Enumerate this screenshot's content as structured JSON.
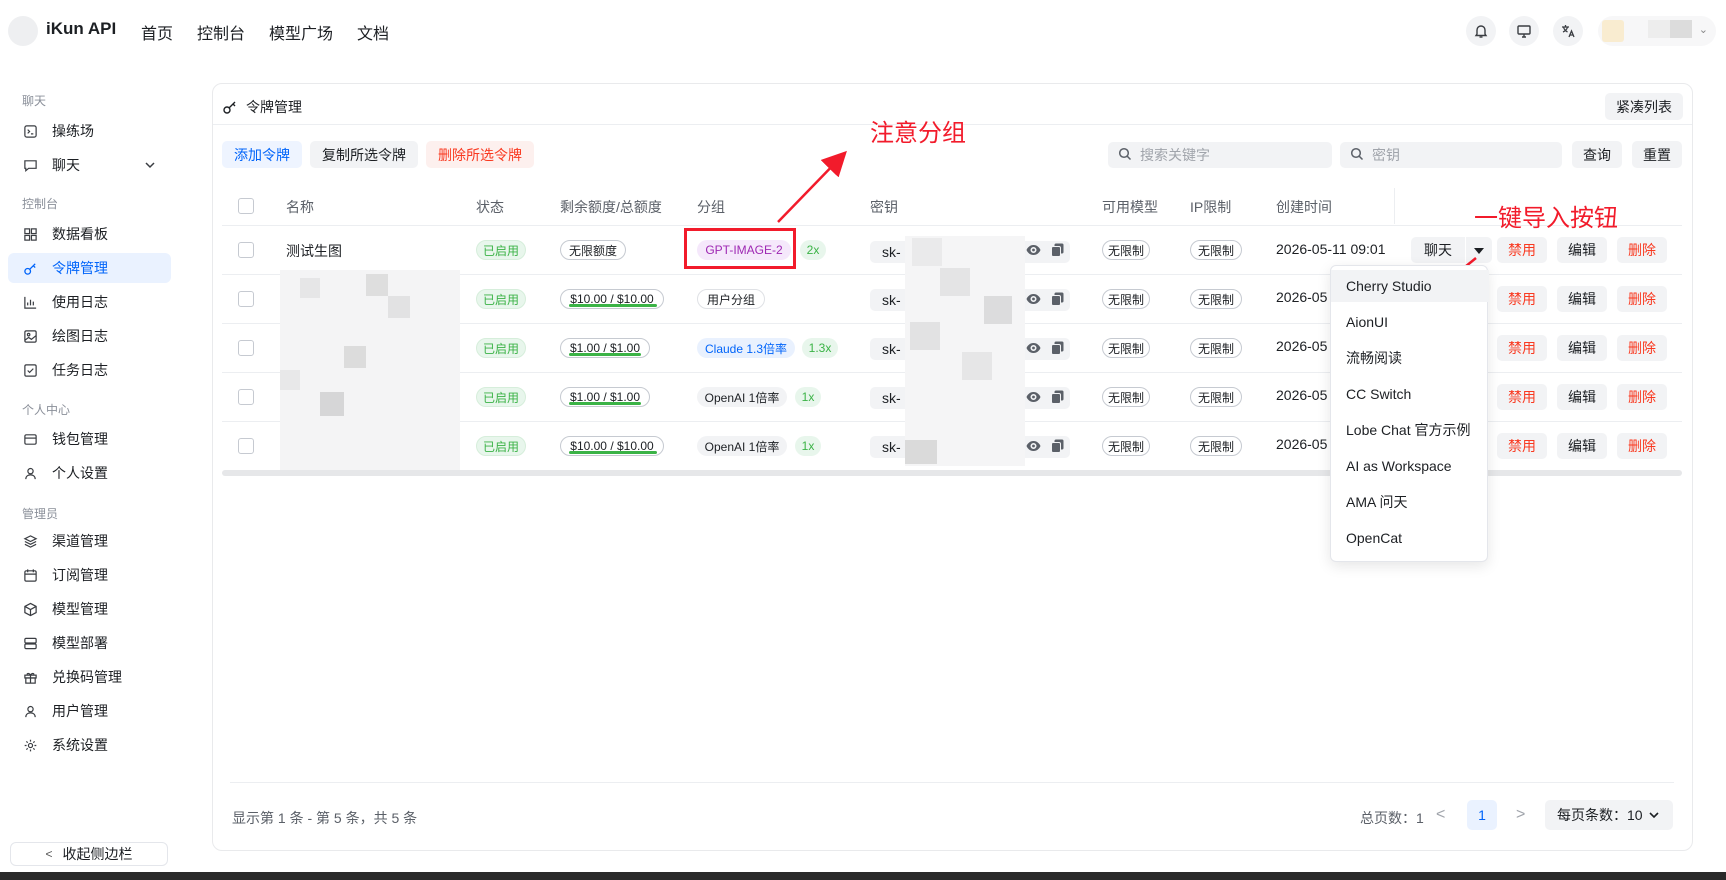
{
  "header": {
    "brand": "iKun API",
    "nav": [
      "首页",
      "控制台",
      "模型广场",
      "文档"
    ]
  },
  "sidebar": {
    "groups": [
      {
        "label": "聊天",
        "items": [
          {
            "label": "操练场",
            "icon": "terminal-icon"
          },
          {
            "label": "聊天",
            "icon": "chat-icon",
            "expandable": true
          }
        ]
      },
      {
        "label": "控制台",
        "items": [
          {
            "label": "数据看板",
            "icon": "dashboard-icon"
          },
          {
            "label": "令牌管理",
            "icon": "key-icon",
            "active": true
          },
          {
            "label": "使用日志",
            "icon": "bar-chart-icon"
          },
          {
            "label": "绘图日志",
            "icon": "image-icon"
          },
          {
            "label": "任务日志",
            "icon": "checklist-icon"
          }
        ]
      },
      {
        "label": "个人中心",
        "items": [
          {
            "label": "钱包管理",
            "icon": "wallet-icon"
          },
          {
            "label": "个人设置",
            "icon": "user-icon"
          }
        ]
      },
      {
        "label": "管理员",
        "items": [
          {
            "label": "渠道管理",
            "icon": "layers-icon"
          },
          {
            "label": "订阅管理",
            "icon": "calendar-icon"
          },
          {
            "label": "模型管理",
            "icon": "cube-icon"
          },
          {
            "label": "模型部署",
            "icon": "server-icon"
          },
          {
            "label": "兑换码管理",
            "icon": "gift-icon"
          },
          {
            "label": "用户管理",
            "icon": "user-icon"
          },
          {
            "label": "系统设置",
            "icon": "gear-icon"
          }
        ]
      }
    ],
    "collapse_label": "收起侧边栏"
  },
  "card": {
    "title": "令牌管理",
    "compact_label": "紧凑列表",
    "toolbar": {
      "add": "添加令牌",
      "copy": "复制所选令牌",
      "delete": "删除所选令牌",
      "search_placeholder": "搜索关键字",
      "key_placeholder": "密钥",
      "query": "查询",
      "reset": "重置"
    },
    "columns": [
      "名称",
      "状态",
      "剩余额度/总额度",
      "分组",
      "密钥",
      "可用模型",
      "IP限制",
      "创建时间"
    ],
    "rows": [
      {
        "name": "测试生图",
        "status": "已启用",
        "quota": "无限额度",
        "quota_fill": 0,
        "group": "GPT-IMAGE-2",
        "group_color": "purple",
        "ratio": "2x",
        "key": "sk-",
        "models": "无限制",
        "ip": "无限制",
        "created": "2026-05-11 09:01"
      },
      {
        "name": "",
        "status": "已启用",
        "quota": "$10.00 / $10.00",
        "quota_fill": 1,
        "group": "用户分组",
        "group_color": "gray",
        "ratio": "",
        "key": "sk-",
        "models": "无限制",
        "ip": "无限制",
        "created": "2026-05"
      },
      {
        "name": "",
        "status": "已启用",
        "quota": "$1.00 / $1.00",
        "quota_fill": 1,
        "group": "Claude 1.3倍率",
        "group_color": "blue",
        "ratio": "1.3x",
        "key": "sk-",
        "models": "无限制",
        "ip": "无限制",
        "created": "2026-05"
      },
      {
        "name": "",
        "status": "已启用",
        "quota": "$1.00 / $1.00",
        "quota_fill": 1,
        "group": "OpenAI 1倍率",
        "group_color": "gray",
        "ratio": "1x",
        "key": "sk-",
        "models": "无限制",
        "ip": "无限制",
        "created": "2026-05"
      },
      {
        "name": "",
        "status": "已启用",
        "quota": "$10.00 / $10.00",
        "quota_fill": 1,
        "group": "OpenAI 1倍率",
        "group_color": "gray",
        "ratio": "1x",
        "key": "sk-",
        "models": "无限制",
        "ip": "无限制",
        "created": "2026-05"
      }
    ],
    "actions": {
      "chat": "聊天",
      "disable": "禁用",
      "edit": "编辑",
      "delete": "删除"
    },
    "dropdown": [
      "Cherry Studio",
      "AionUI",
      "流畅阅读",
      "CC Switch",
      "Lobe Chat 官方示例",
      "AI as Workspace",
      "AMA 问天",
      "OpenCat"
    ],
    "footer": {
      "summary": "显示第 1 条 - 第 5 条，共 5 条",
      "total_pages": "总页数：1",
      "current_page": "1",
      "page_size": "每页条数：10"
    }
  },
  "annotations": {
    "group_note": "注意分组",
    "import_note": "一键导入按钮",
    "color": "#f21b2b"
  }
}
